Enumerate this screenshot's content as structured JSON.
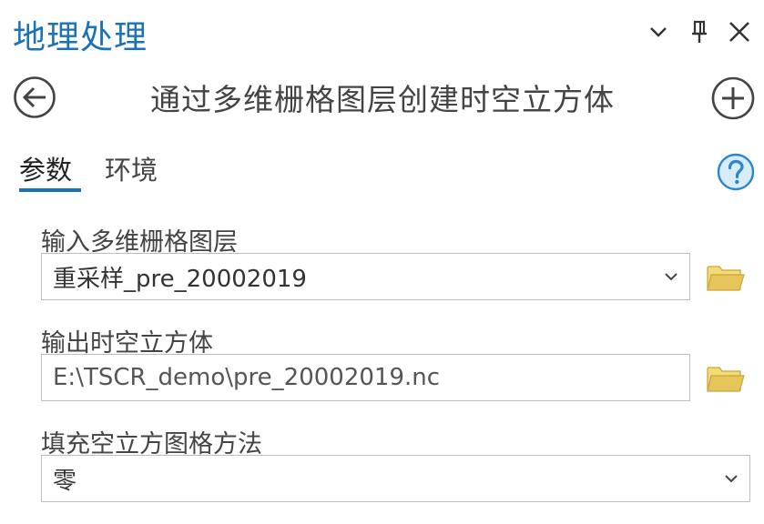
{
  "pane": {
    "title": "地理处理",
    "controls": [
      "chevron-down-icon",
      "pin-icon",
      "close-icon"
    ]
  },
  "tool": {
    "title": "通过多维栅格图层创建时空立方体"
  },
  "tabs": [
    {
      "label": "参数",
      "active": true
    },
    {
      "label": "环境",
      "active": false
    }
  ],
  "params": {
    "input_layer": {
      "label": "输入多维栅格图层",
      "value": "重采样_pre_20002019"
    },
    "output_cube": {
      "label": "输出时空立方体",
      "value": "E:\\TSCR_demo\\pre_20002019.nc"
    },
    "fill_method": {
      "label": "填充空立方图格方法",
      "value": "零"
    }
  },
  "colors": {
    "accent": "#1a73b8",
    "folder": "#e6c65a",
    "icon": "#444444"
  }
}
